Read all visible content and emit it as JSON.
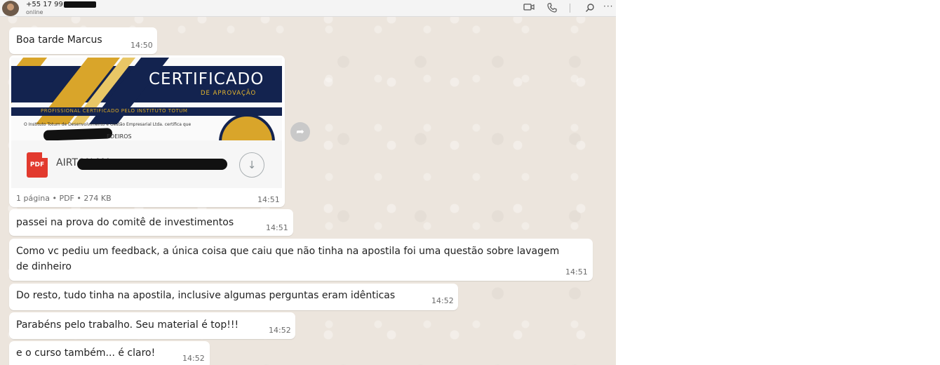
{
  "header": {
    "phone": "+55 17 99",
    "status": "online",
    "icons": [
      "video-icon",
      "phone-call-icon",
      "search-icon",
      "more-icon"
    ]
  },
  "messages": [
    {
      "text": "Boa tarde Marcus",
      "time": "14:50"
    },
    {
      "type": "document",
      "preview": {
        "title": "CERTIFICADO",
        "subtitle": "DE APROVAÇÃO",
        "band_text": "PROFISSIONAL CERTIFICADO PELO INSTITUTO TOTUM",
        "body_text": "O Instituto Totum de Desenvolvimento e Gestão Empresarial Ltda. certifica que",
        "name_fragment": "EDEIROS"
      },
      "file_name": "AIRTON MA",
      "meta": "1 página • PDF • 274 KB",
      "time": "14:51"
    },
    {
      "text": "passei na prova do comitê de investimentos",
      "time": "14:51"
    },
    {
      "text_line1": "Como vc pediu um feedback, a única coisa que caiu que não tinha na apostila foi uma questão sobre lavagem",
      "text_line2": "de dinheiro",
      "time": "14:51"
    },
    {
      "text": "Do resto, tudo tinha na apostila, inclusive algumas perguntas eram idênticas",
      "time": "14:52"
    },
    {
      "text": "Parabéns pelo trabalho. Seu material é top!!!",
      "time": "14:52"
    },
    {
      "text": "e o curso também... é claro!",
      "time": "14:52"
    }
  ],
  "icons": {
    "pdf": "PDF",
    "download": "↓",
    "forward": "➦"
  },
  "colors": {
    "chat_bg": "#ece5dd",
    "bubble": "#ffffff",
    "cert_navy": "#13234f",
    "cert_gold": "#d9a52a",
    "pdf_red": "#e23a2e"
  }
}
